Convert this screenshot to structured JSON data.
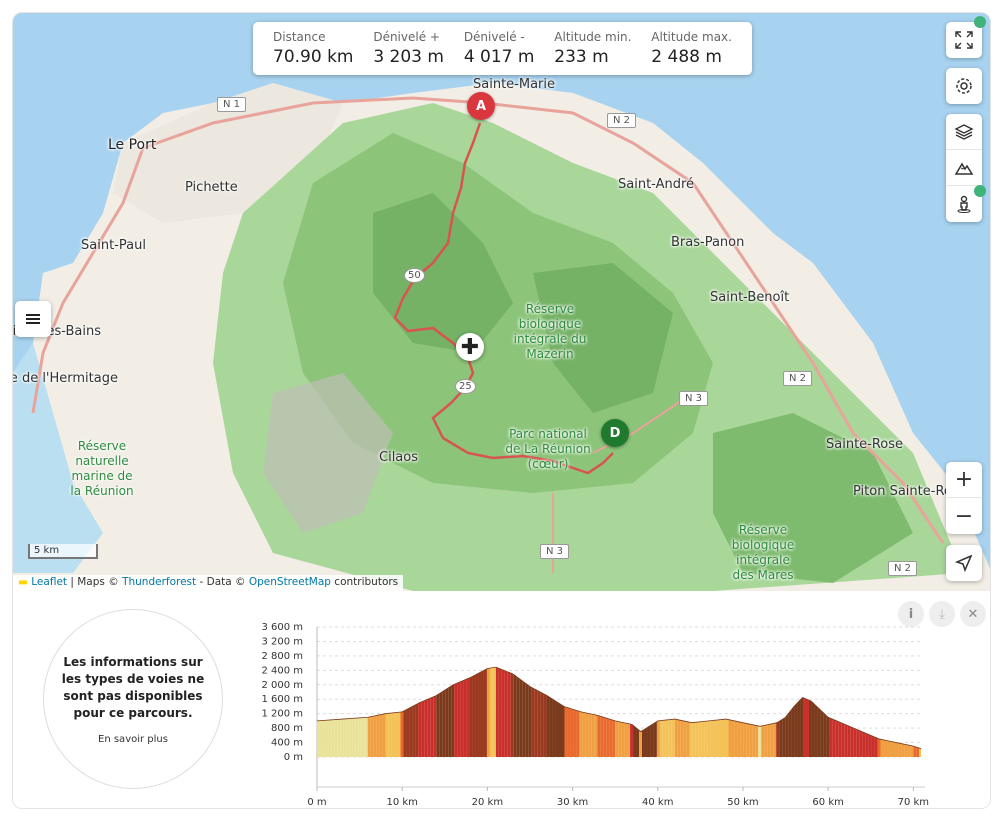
{
  "stats": [
    {
      "label": "Distance",
      "value": "70.90 km"
    },
    {
      "label": "Dénivelé +",
      "value": "3 203 m"
    },
    {
      "label": "Dénivelé -",
      "value": "4 017 m"
    },
    {
      "label": "Altitude min.",
      "value": "233 m"
    },
    {
      "label": "Altitude max.",
      "value": "2 488 m"
    }
  ],
  "places": {
    "sainte_marie": "Sainte-Marie",
    "le_port": "Le Port",
    "pichette": "Pichette",
    "saint_andre": "Saint-André",
    "saint_paul": "Saint-Paul",
    "bras_panon": "Bras-Panon",
    "saint_benoit": "Saint-Benoît",
    "st_gilles": "Saint-Gilles-les-Bains",
    "hermitage": "Plage de l'Hermitage",
    "reserve_mazerin": "Réserve biologique intégrale du Mazerin",
    "parc_national": "Parc national de La Réunion (cœur)",
    "cilaos": "Cilaos",
    "sainte_rose": "Sainte-Rose",
    "piton_sainte_rose": "Piton Sainte-Rose",
    "reserve_marine": "Réserve naturelle marine de la Réunion",
    "reserve_mares": "Réserve biologique intégrale des Mares"
  },
  "roads": {
    "n1": "N 1",
    "n2a": "N 2",
    "n2b": "N 2",
    "n2c": "N 2",
    "n3a": "N 3",
    "n3b": "N 3",
    "r50": "50",
    "r25": "25"
  },
  "markers": {
    "start": "A",
    "end": "D"
  },
  "scale": "5 km",
  "attribution": {
    "leaflet": "Leaflet",
    "sep1": " | Maps © ",
    "thunderforest": "Thunderforest",
    "sep2": " - Data © ",
    "osm": "OpenStreetMap",
    "sep3": " contributors"
  },
  "info_panel": {
    "message": "Les informations sur les types de voies ne sont pas disponibles pour ce parcours.",
    "link": "En savoir plus"
  },
  "icons": [
    "fullscreen-icon",
    "settings-icon",
    "layers-icon",
    "terrain-icon",
    "street-view-icon",
    "zoom-in-icon",
    "zoom-out-icon",
    "locate-icon",
    "menu-icon",
    "info-icon",
    "download-icon",
    "close-icon"
  ],
  "colors": {
    "route": "#d9534f",
    "start_marker": "#d9363e",
    "end_marker": "#1f7a2e",
    "sea": "#a8d3f0",
    "forest": "#9dd08c"
  },
  "chart_data": {
    "type": "area",
    "xlabel": "",
    "ylabel": "",
    "x_ticks": [
      "0 m",
      "10 km",
      "20 km",
      "30 km",
      "40 km",
      "50 km",
      "60 km",
      "70 km"
    ],
    "y_ticks": [
      "0 m",
      "400 m",
      "800 m",
      "1 200 m",
      "1 600 m",
      "2 000 m",
      "2 400 m",
      "2 800 m",
      "3 200 m",
      "3 600 m"
    ],
    "xlim": [
      0,
      70.9
    ],
    "ylim": [
      0,
      3600
    ],
    "x": [
      0,
      3,
      6,
      8,
      10,
      12,
      14,
      16,
      18,
      20,
      21,
      23,
      25,
      27,
      29,
      31,
      33,
      35,
      37,
      38,
      40,
      42,
      44,
      46,
      48,
      50,
      52,
      54,
      55,
      56,
      57,
      58,
      60,
      62,
      64,
      66,
      68,
      70,
      70.9
    ],
    "y": [
      1000,
      1050,
      1100,
      1200,
      1250,
      1500,
      1700,
      2000,
      2200,
      2450,
      2488,
      2300,
      1950,
      1700,
      1400,
      1250,
      1150,
      1000,
      900,
      700,
      1000,
      1050,
      950,
      1000,
      1050,
      950,
      850,
      950,
      1100,
      1400,
      1650,
      1550,
      1100,
      900,
      700,
      500,
      400,
      300,
      233
    ]
  }
}
